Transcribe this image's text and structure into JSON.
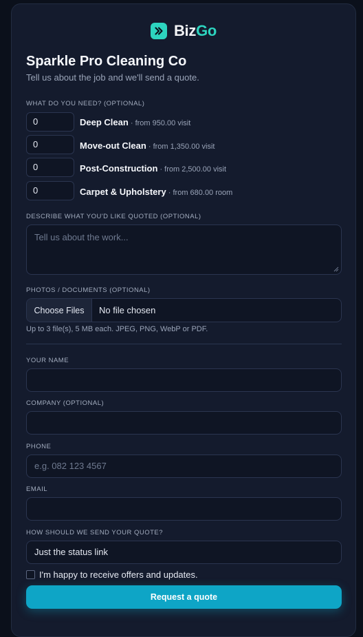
{
  "brand": {
    "name_part1": "Biz",
    "name_part2": "Go"
  },
  "header": {
    "title": "Sparkle Pro Cleaning Co",
    "subtitle": "Tell us about the job and we'll send a quote."
  },
  "services": {
    "label": "WHAT DO YOU NEED? (OPTIONAL)",
    "items": [
      {
        "qty": "0",
        "name": "Deep Clean",
        "price": " · from 950.00 visit"
      },
      {
        "qty": "0",
        "name": "Move-out Clean",
        "price": " · from 1,350.00 visit"
      },
      {
        "qty": "0",
        "name": "Post-Construction",
        "price": " · from 2,500.00 visit"
      },
      {
        "qty": "0",
        "name": "Carpet & Upholstery",
        "price": " · from 680.00 room"
      }
    ]
  },
  "description": {
    "label": "DESCRIBE WHAT YOU'D LIKE QUOTED (OPTIONAL)",
    "placeholder": "Tell us about the work..."
  },
  "upload": {
    "label": "PHOTOS / DOCUMENTS (OPTIONAL)",
    "button": "Choose Files",
    "status": "No file chosen",
    "hint": "Up to 3 file(s), 5 MB each. JPEG, PNG, WebP or PDF."
  },
  "contact": {
    "name_label": "YOUR NAME",
    "company_label": "COMPANY (OPTIONAL)",
    "phone_label": "PHONE",
    "phone_placeholder": "e.g. 082 123 4567",
    "email_label": "EMAIL",
    "send_label": "HOW SHOULD WE SEND YOUR QUOTE?",
    "send_value": "Just the status link"
  },
  "consent": {
    "label": "I'm happy to receive offers and updates."
  },
  "submit": {
    "label": "Request a quote"
  },
  "colors": {
    "accent": "#0ea5c6",
    "brand": "#2dd4bf",
    "card": "#141b2d",
    "background": "#0b101b"
  }
}
